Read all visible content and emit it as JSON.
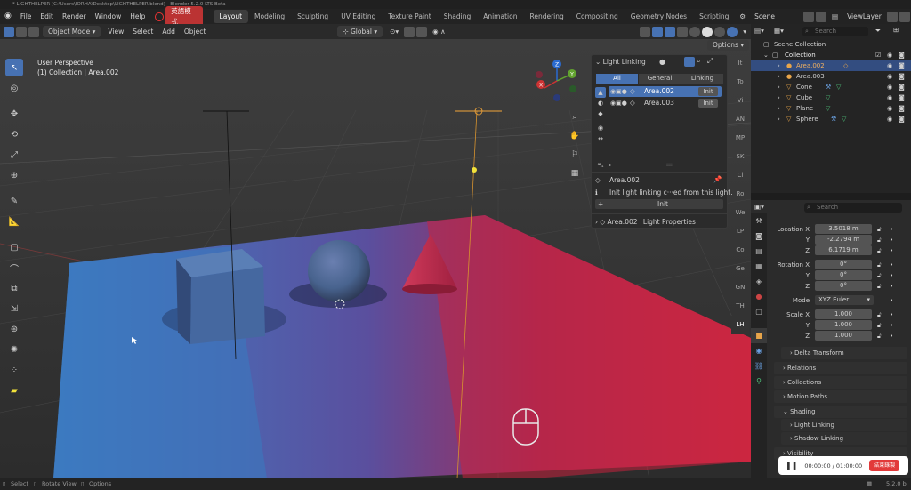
{
  "window": {
    "title": "* LIGHTHELPER [C:\\Users\\IORHA\\Desktop\\LIGHTHELPER.blend] - Blender 5.2.0 LTS Beta"
  },
  "menu": {
    "file": "File",
    "edit": "Edit",
    "render": "Render",
    "window": "Window",
    "help": "Help",
    "lang": "英語模式"
  },
  "workspaces": [
    "Layout",
    "Modeling",
    "Sculpting",
    "UV Editing",
    "Texture Paint",
    "Shading",
    "Animation",
    "Rendering",
    "Compositing",
    "Geometry Nodes",
    "Scripting"
  ],
  "scene": {
    "scene_label": "Scene",
    "view_layer": "ViewLayer"
  },
  "viewport_header": {
    "mode": "Object Mode",
    "view": "View",
    "select": "Select",
    "add": "Add",
    "object": "Object",
    "orientation": "Global",
    "options": "Options"
  },
  "viewport": {
    "view_name": "User Perspective",
    "context": "(1) Collection | Area.002"
  },
  "gizmo": {
    "z": "Z",
    "y": "Y",
    "x": "X"
  },
  "light_linking": {
    "title": "Light Linking",
    "tabs": [
      "All",
      "General",
      "Linking"
    ],
    "items": [
      {
        "name": "Area.002",
        "btn": "Init"
      },
      {
        "name": "Area.003",
        "btn": "Init"
      }
    ],
    "active_name": "Area.002",
    "info": "Init light linking c···ed from this light.",
    "init_btn": "Init",
    "footer_obj": "Area.002",
    "footer_props": "Light Properties"
  },
  "side_tabs": [
    "It",
    "To",
    "Vi",
    "AN",
    "MP",
    "SK",
    "Cl",
    "Ro",
    "We",
    "LP",
    "Co",
    "Ge",
    "GN",
    "TH",
    "LH"
  ],
  "outliner": {
    "search_placeholder": "Search",
    "root": "Scene Collection",
    "collection": "Collection",
    "objects": [
      "Area.002",
      "Area.003",
      "Cone",
      "Cube",
      "Plane",
      "Sphere"
    ]
  },
  "properties": {
    "search_placeholder": "Search",
    "location": {
      "label": "Location X",
      "x": "3.5018 m",
      "y": "-2.2794 m",
      "z": "6.1719 m"
    },
    "rotation": {
      "label": "Rotation X",
      "x": "0°",
      "y": "0°",
      "z": "0°"
    },
    "mode_label": "Mode",
    "mode_value": "XYZ Euler",
    "scale": {
      "label": "Scale X",
      "x": "1.000",
      "y": "1.000",
      "z": "1.000"
    },
    "y_label": "Y",
    "z_label": "Z",
    "sections": [
      "Delta Transform",
      "Relations",
      "Collections",
      "Motion Paths",
      "Shading",
      "Light Linking",
      "Shadow Linking",
      "Visibility"
    ]
  },
  "recorder": {
    "time": "00:00:00 / 01:00:00",
    "btn": "結束錄製"
  },
  "status": {
    "select": "Select",
    "rotate": "Rotate View",
    "options": "Options",
    "version": "5.2.0 b"
  },
  "colors": {
    "accent": "#4772b3",
    "plane_red": "#d02a43",
    "plane_blue": "#3f7ec4"
  }
}
